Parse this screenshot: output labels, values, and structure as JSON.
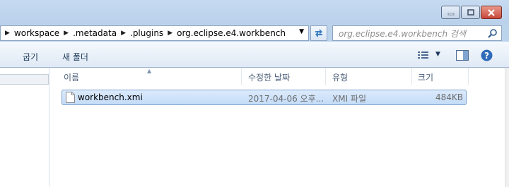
{
  "address": {
    "crumbs": [
      "workspace",
      ".metadata",
      ".plugins",
      "org.eclipse.e4.workbench"
    ]
  },
  "search": {
    "placeholder": "org.eclipse.e4.workbench 검색"
  },
  "toolbar": {
    "burn_label": "굽기",
    "new_folder_label": "새 폴더"
  },
  "columns": {
    "name": "이름",
    "date": "수정한 날짜",
    "type": "유형",
    "size": "크기"
  },
  "files": [
    {
      "name": "workbench.xmi",
      "date": "2017-04-06 오후...",
      "type": "XMI 파일",
      "size": "484KB"
    }
  ],
  "icons": {
    "minimize": "minimize-icon",
    "maximize": "maximize-icon",
    "close": "close-icon",
    "refresh": "refresh-icon",
    "search": "search-icon",
    "views": "views-icon",
    "preview": "preview-pane-icon",
    "help": "help-icon",
    "file": "file-icon"
  },
  "colors": {
    "selection": "#c4dcf8",
    "titlebar": "#b9d1ea",
    "accent": "#1e395b"
  }
}
